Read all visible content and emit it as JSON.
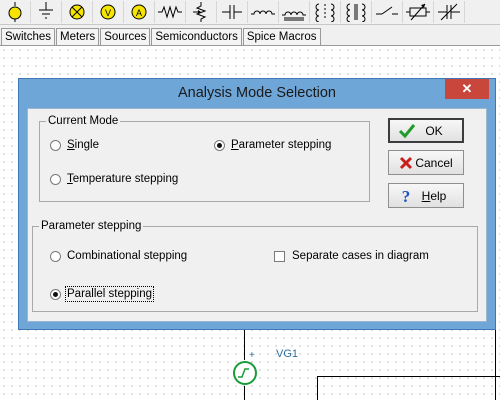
{
  "toolbar": {
    "icons": [
      "ammeter-icon",
      "ground-icon",
      "lamp-icon",
      "voltmeter-icon",
      "ammeter-meter-icon",
      "resistor-icon",
      "potentiometer-icon",
      "capacitor-icon",
      "inductor-icon",
      "transformer-icon",
      "coupled-inductor-icon",
      "transformer-core-icon",
      "switch-icon",
      "variable-resistor-icon",
      "variable-capacitor-icon"
    ]
  },
  "tabs": [
    "Switches",
    "Meters",
    "Sources",
    "Semiconductors",
    "Spice Macros"
  ],
  "schematic": {
    "source_label": "VG1",
    "polarity": "+"
  },
  "dialog": {
    "title": "Analysis Mode Selection",
    "close_label": "✕",
    "current_mode": {
      "legend": "Current Mode",
      "options": [
        {
          "pre": "",
          "acc": "S",
          "post": "ingle",
          "checked": false
        },
        {
          "pre": "",
          "acc": "P",
          "post": "arameter stepping",
          "checked": true
        },
        {
          "pre": "",
          "acc": "T",
          "post": "emperature stepping",
          "checked": false
        }
      ]
    },
    "parameter_stepping": {
      "legend": "Parameter stepping",
      "options": [
        {
          "label": "Combinational stepping",
          "checked": false
        },
        {
          "label": "Parallel stepping",
          "checked": true
        }
      ],
      "separate_cases": {
        "label": "Separate cases in diagram",
        "checked": false
      }
    },
    "buttons": {
      "ok": "OK",
      "cancel": "Cancel",
      "help_pre": "",
      "help_acc": "H",
      "help_post": "elp"
    },
    "colors": {
      "ok_check": "#1e9b2a",
      "cancel_x": "#c8201c",
      "help_q": "#1d57c7",
      "title_bar": "#6fa6d8",
      "close": "#c9463d"
    }
  }
}
